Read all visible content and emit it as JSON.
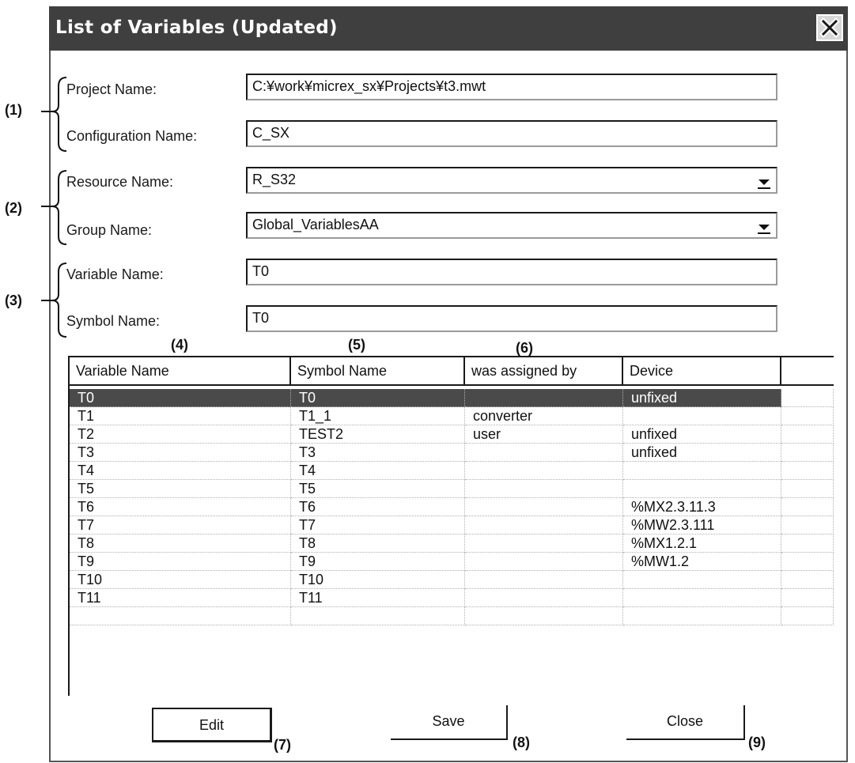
{
  "window": {
    "title": "List of Variables (Updated)"
  },
  "form": {
    "project_label": "Project Name:",
    "project_value": "C:¥work¥micrex_sx¥Projects¥t3.mwt",
    "configuration_label": "Configuration Name:",
    "configuration_value": "C_SX",
    "resource_label": "Resource Name:",
    "resource_value": "R_S32",
    "group_label": "Group Name:",
    "group_value": "Global_VariablesAA",
    "variable_label": "Variable Name:",
    "variable_value": "T0",
    "symbol_label": "Symbol Name:",
    "symbol_value": "T0"
  },
  "callouts": {
    "c1": "(1)",
    "c2": "(2)",
    "c3": "(3)",
    "c4": "(4)",
    "c5": "(5)",
    "c6": "(6)",
    "c7": "(7)",
    "c8": "(8)",
    "c9": "(9)"
  },
  "table": {
    "columns": [
      "Variable Name",
      "Symbol Name",
      "was assigned by",
      "Device"
    ],
    "rows": [
      [
        "T0",
        "T0",
        "",
        "unfixed"
      ],
      [
        "T1",
        "T1_1",
        "converter",
        ""
      ],
      [
        "T2",
        "TEST2",
        "user",
        "unfixed"
      ],
      [
        "T3",
        "T3",
        "",
        "unfixed"
      ],
      [
        "T4",
        "T4",
        "",
        ""
      ],
      [
        "T5",
        "T5",
        "",
        ""
      ],
      [
        "T6",
        "T6",
        "",
        "%MX2.3.11.3"
      ],
      [
        "T7",
        "T7",
        "",
        "%MW2.3.111"
      ],
      [
        "T8",
        "T8",
        "",
        "%MX1.2.1"
      ],
      [
        "T9",
        "T9",
        "",
        "%MW1.2"
      ],
      [
        "T10",
        "T10",
        "",
        ""
      ],
      [
        "T11",
        "T11",
        "",
        ""
      ]
    ],
    "selected_row": 0
  },
  "buttons": {
    "edit": "Edit",
    "save": "Save",
    "close": "Close"
  },
  "colors": {
    "titlebar": "#3f3f3f",
    "selection": "#4a4a4a"
  }
}
